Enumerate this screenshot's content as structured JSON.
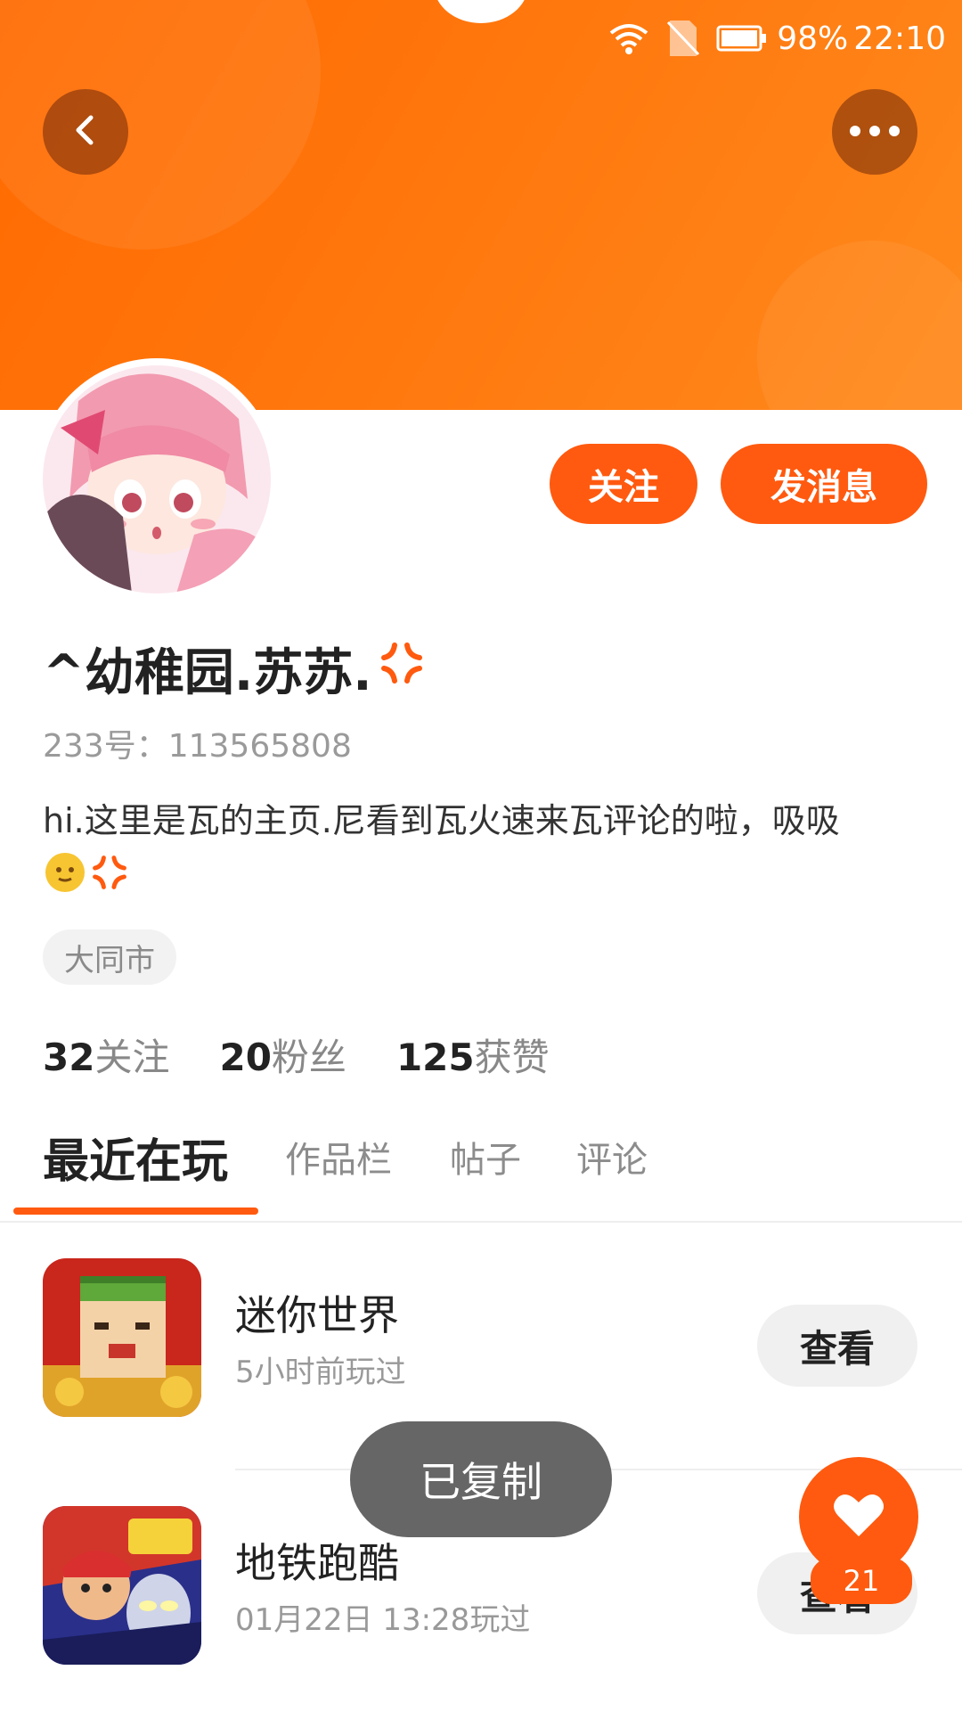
{
  "status_bar": {
    "battery": "98%",
    "time": "22:10"
  },
  "header": {
    "back_icon": "chevron-left-icon",
    "more_icon": "ellipsis-icon"
  },
  "profile": {
    "name": "^幼稚园.苏苏.",
    "uid": "233号：113565808",
    "bio": "hi.这里是瓦的主页.尼看到瓦火速来瓦评论的啦，吸吸",
    "location": "大同市",
    "stats": [
      {
        "num": "32",
        "label": "关注"
      },
      {
        "num": "20",
        "label": "粉丝"
      },
      {
        "num": "125",
        "label": "获赞"
      }
    ]
  },
  "actions": {
    "follow": "关注",
    "message": "发消息"
  },
  "tabs": [
    "最近在玩",
    "作品栏",
    "帖子",
    "评论"
  ],
  "games": [
    {
      "name": "迷你世界",
      "time": "5小时前玩过",
      "button": "查看"
    },
    {
      "name": "地铁跑酷",
      "time": "01月22日 13:28玩过",
      "button": "查看"
    }
  ],
  "toast": "已复制",
  "like": {
    "count": "21"
  },
  "colors": {
    "accent": "#ff5a0f",
    "header": "#ff7a10"
  }
}
